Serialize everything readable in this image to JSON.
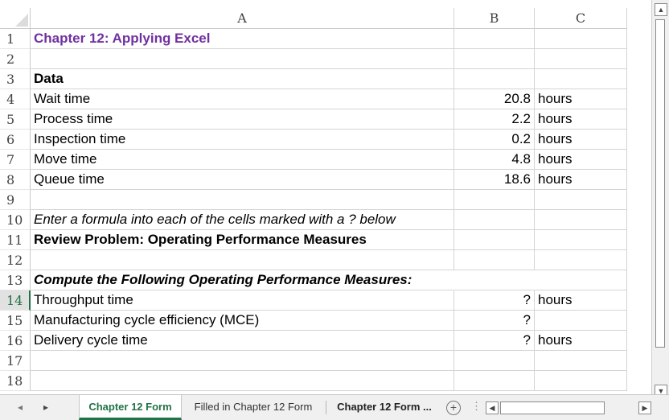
{
  "columns": [
    "A",
    "B",
    "C"
  ],
  "rows": [
    {
      "num": "1",
      "a": "Chapter 12: Applying Excel",
      "b": "",
      "c": ""
    },
    {
      "num": "2",
      "a": "",
      "b": "",
      "c": ""
    },
    {
      "num": "3",
      "a": "Data",
      "b": "",
      "c": ""
    },
    {
      "num": "4",
      "a": "Wait time",
      "b": "20.8",
      "c": "hours"
    },
    {
      "num": "5",
      "a": "Process time",
      "b": "2.2",
      "c": "hours"
    },
    {
      "num": "6",
      "a": "Inspection time",
      "b": "0.2",
      "c": "hours"
    },
    {
      "num": "7",
      "a": "Move time",
      "b": "4.8",
      "c": "hours"
    },
    {
      "num": "8",
      "a": "Queue time",
      "b": "18.6",
      "c": "hours"
    },
    {
      "num": "9",
      "a": "",
      "b": "",
      "c": ""
    },
    {
      "num": "10",
      "a": "Enter a formula into each of the cells marked with a ? below",
      "b": "",
      "c": ""
    },
    {
      "num": "11",
      "a": "Review Problem: Operating Performance Measures",
      "b": "",
      "c": ""
    },
    {
      "num": "12",
      "a": "",
      "b": "",
      "c": ""
    },
    {
      "num": "13",
      "a": "Compute the Following Operating Performance Measures:",
      "b": "",
      "c": ""
    },
    {
      "num": "14",
      "a": "Throughput time",
      "b": "?",
      "c": "hours"
    },
    {
      "num": "15",
      "a": "Manufacturing cycle efficiency (MCE)",
      "b": "?",
      "c": ""
    },
    {
      "num": "16",
      "a": "Delivery cycle time",
      "b": "?",
      "c": "hours"
    },
    {
      "num": "17",
      "a": "",
      "b": "",
      "c": ""
    },
    {
      "num": "18",
      "a": "",
      "b": "",
      "c": ""
    }
  ],
  "active_row": "14",
  "tabs": {
    "prev_icon": "◂",
    "next_icon": "▸",
    "items": [
      "Chapter 12 Form",
      "Filled in Chapter 12 Form",
      "Chapter 12 Form ..."
    ],
    "active_index": 0,
    "add_icon": "+",
    "more_icon": "⋮"
  },
  "colors": {
    "title_purple": "#7030a0",
    "accent_green": "#217346"
  }
}
